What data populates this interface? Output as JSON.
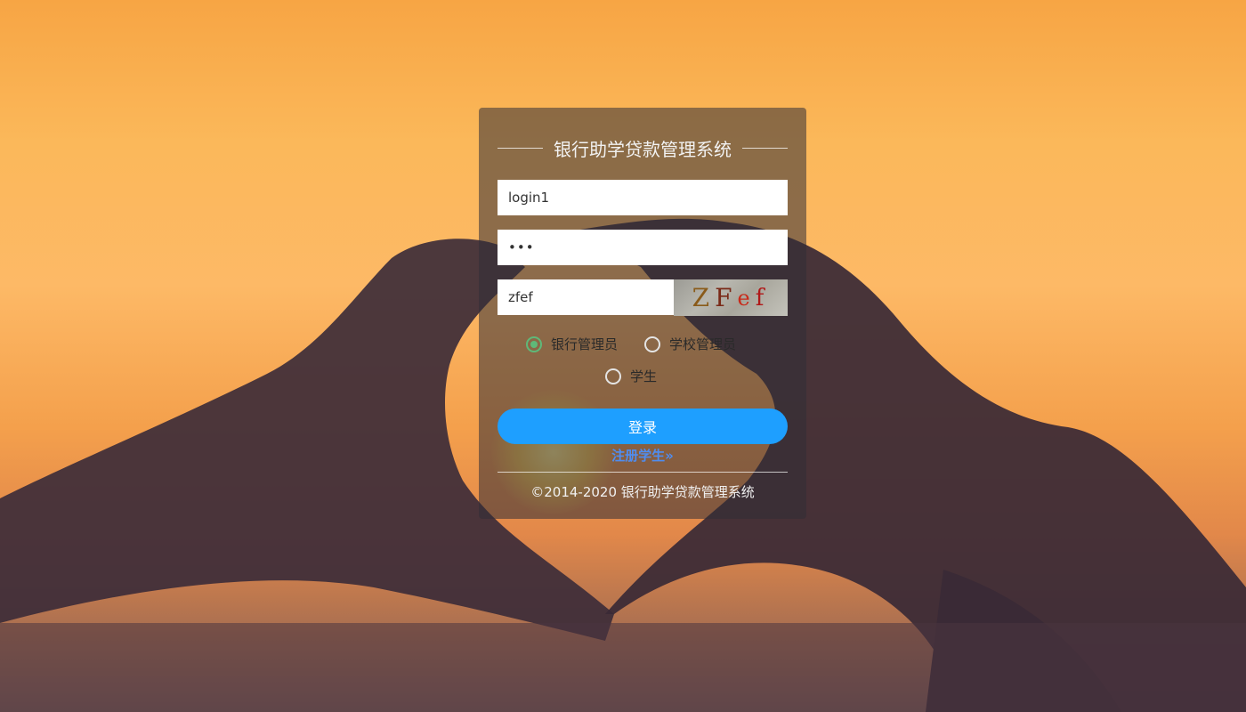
{
  "login": {
    "title": "银行助学贷款管理系统",
    "username_value": "login1",
    "password_value": "•••",
    "captcha_value": "zfef",
    "captcha_chars": [
      "Z",
      "F",
      "e",
      "f"
    ],
    "roles": [
      {
        "label": "银行管理员",
        "checked": true
      },
      {
        "label": "学校管理员",
        "checked": false
      },
      {
        "label": "学生",
        "checked": false
      }
    ],
    "login_button": "登录",
    "register_link": "注册学生»",
    "copyright": "©2014-2020 银行助学贷款管理系统"
  },
  "colors": {
    "accent": "#1e9fff",
    "radio_checked": "#5fb878",
    "link": "#4f8df0"
  }
}
